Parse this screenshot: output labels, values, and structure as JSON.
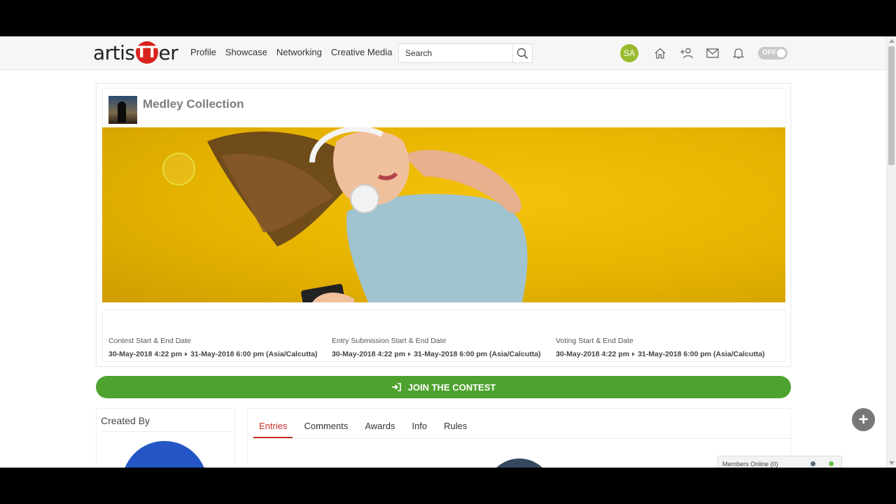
{
  "header": {
    "logo_text_start": "artis",
    "logo_text_mid": "TT",
    "logo_text_end": "er",
    "nav": [
      "Profile",
      "Showcase",
      "Networking",
      "Creative Media"
    ],
    "search_placeholder": "Search",
    "user_initials": "SA",
    "toggle_label": "OFF"
  },
  "contest": {
    "title": "Medley Collection",
    "dates": [
      {
        "label": "Contest Start & End Date",
        "start": "30-May-2018 4:22 pm",
        "end": "31-May-2018 6:00 pm (Asia/Calcutta)"
      },
      {
        "label": "Entry Submission Start & End Date",
        "start": "30-May-2018 4:22 pm",
        "end": "31-May-2018 6:00 pm (Asia/Calcutta)"
      },
      {
        "label": "Voting Start & End Date",
        "start": "30-May-2018 4:22 pm",
        "end": "31-May-2018 6:00 pm (Asia/Calcutta)"
      }
    ],
    "join_label": "JOIN THE CONTEST"
  },
  "created_by": {
    "title": "Created By"
  },
  "tabs": [
    "Entries",
    "Comments",
    "Awards",
    "Info",
    "Rules"
  ],
  "active_tab": "Entries",
  "members": {
    "label": "Members Online (0)"
  },
  "colors": {
    "brand_red": "#d9231d",
    "join_green": "#4ea22f",
    "active_tab": "#c9302c",
    "banner_yellow": "#f4c20a"
  }
}
